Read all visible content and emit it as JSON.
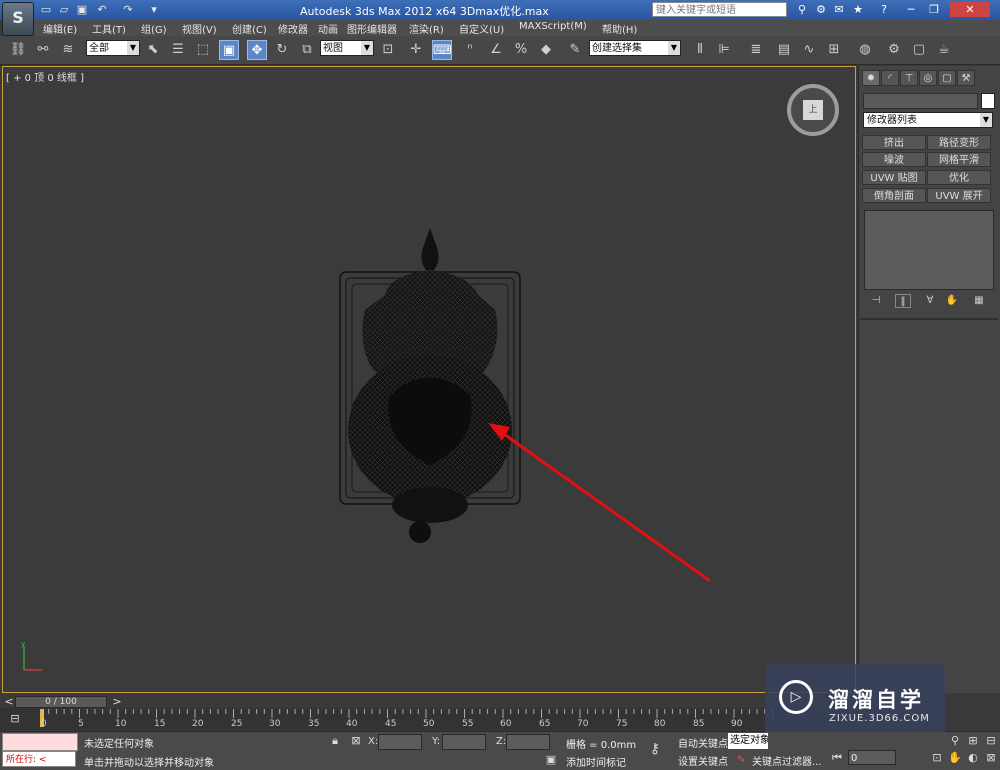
{
  "window": {
    "title": "Autodesk 3ds Max  2012 x64    3Dmax优化.max",
    "help_search_placeholder": "键入关键字或短语",
    "logo_label": "S"
  },
  "menu": [
    "编辑(E)",
    "工具(T)",
    "组(G)",
    "视图(V)",
    "创建(C)",
    "修改器",
    "动画",
    "图形编辑器",
    "渲染(R)",
    "自定义(U)",
    "MAXScript(M)",
    "帮助(H)"
  ],
  "toolbar": {
    "selection_filter": "全部",
    "reference_coord": "视图",
    "named_selection": "创建选择集"
  },
  "viewport": {
    "label": "[ + 0 顶 0 线框 ]",
    "viewcube_face": "上"
  },
  "command_panel": {
    "modifier_list": "修改器列表",
    "modifier_buttons": [
      "挤出",
      "路径变形",
      "噪波",
      "网格平滑",
      "UVW 贴图",
      "优化",
      "倒角剖面",
      "UVW 展开"
    ]
  },
  "timeline": {
    "frame_counter": "0 / 100",
    "ticks": [
      "0",
      "5",
      "10",
      "15",
      "20",
      "25",
      "30",
      "35",
      "40",
      "45",
      "50",
      "55",
      "60",
      "65",
      "70",
      "75",
      "80",
      "85",
      "90"
    ]
  },
  "status": {
    "running_label": "所在行:",
    "selection_status": "未选定任何对象",
    "prompt": "单击并拖动以选择并移动对象",
    "x_label": "X:",
    "y_label": "Y:",
    "z_label": "Z:",
    "grid": "栅格 = 0.0mm",
    "add_time_tag": "添加时间标记",
    "auto_key": "自动关键点",
    "set_key": "设置关键点",
    "selected_set": "选定对象",
    "key_filters": "关键点过滤器...",
    "current_frame": "0"
  },
  "watermark": {
    "brand": "溜溜自学",
    "url": "ZIXUE.3D66.COM"
  },
  "colors": {
    "title_bar": "#3e6fb8",
    "viewport_border": "#c8a23a",
    "annotation_arrow": "#e01010",
    "time_marker": "#e8c13a"
  }
}
